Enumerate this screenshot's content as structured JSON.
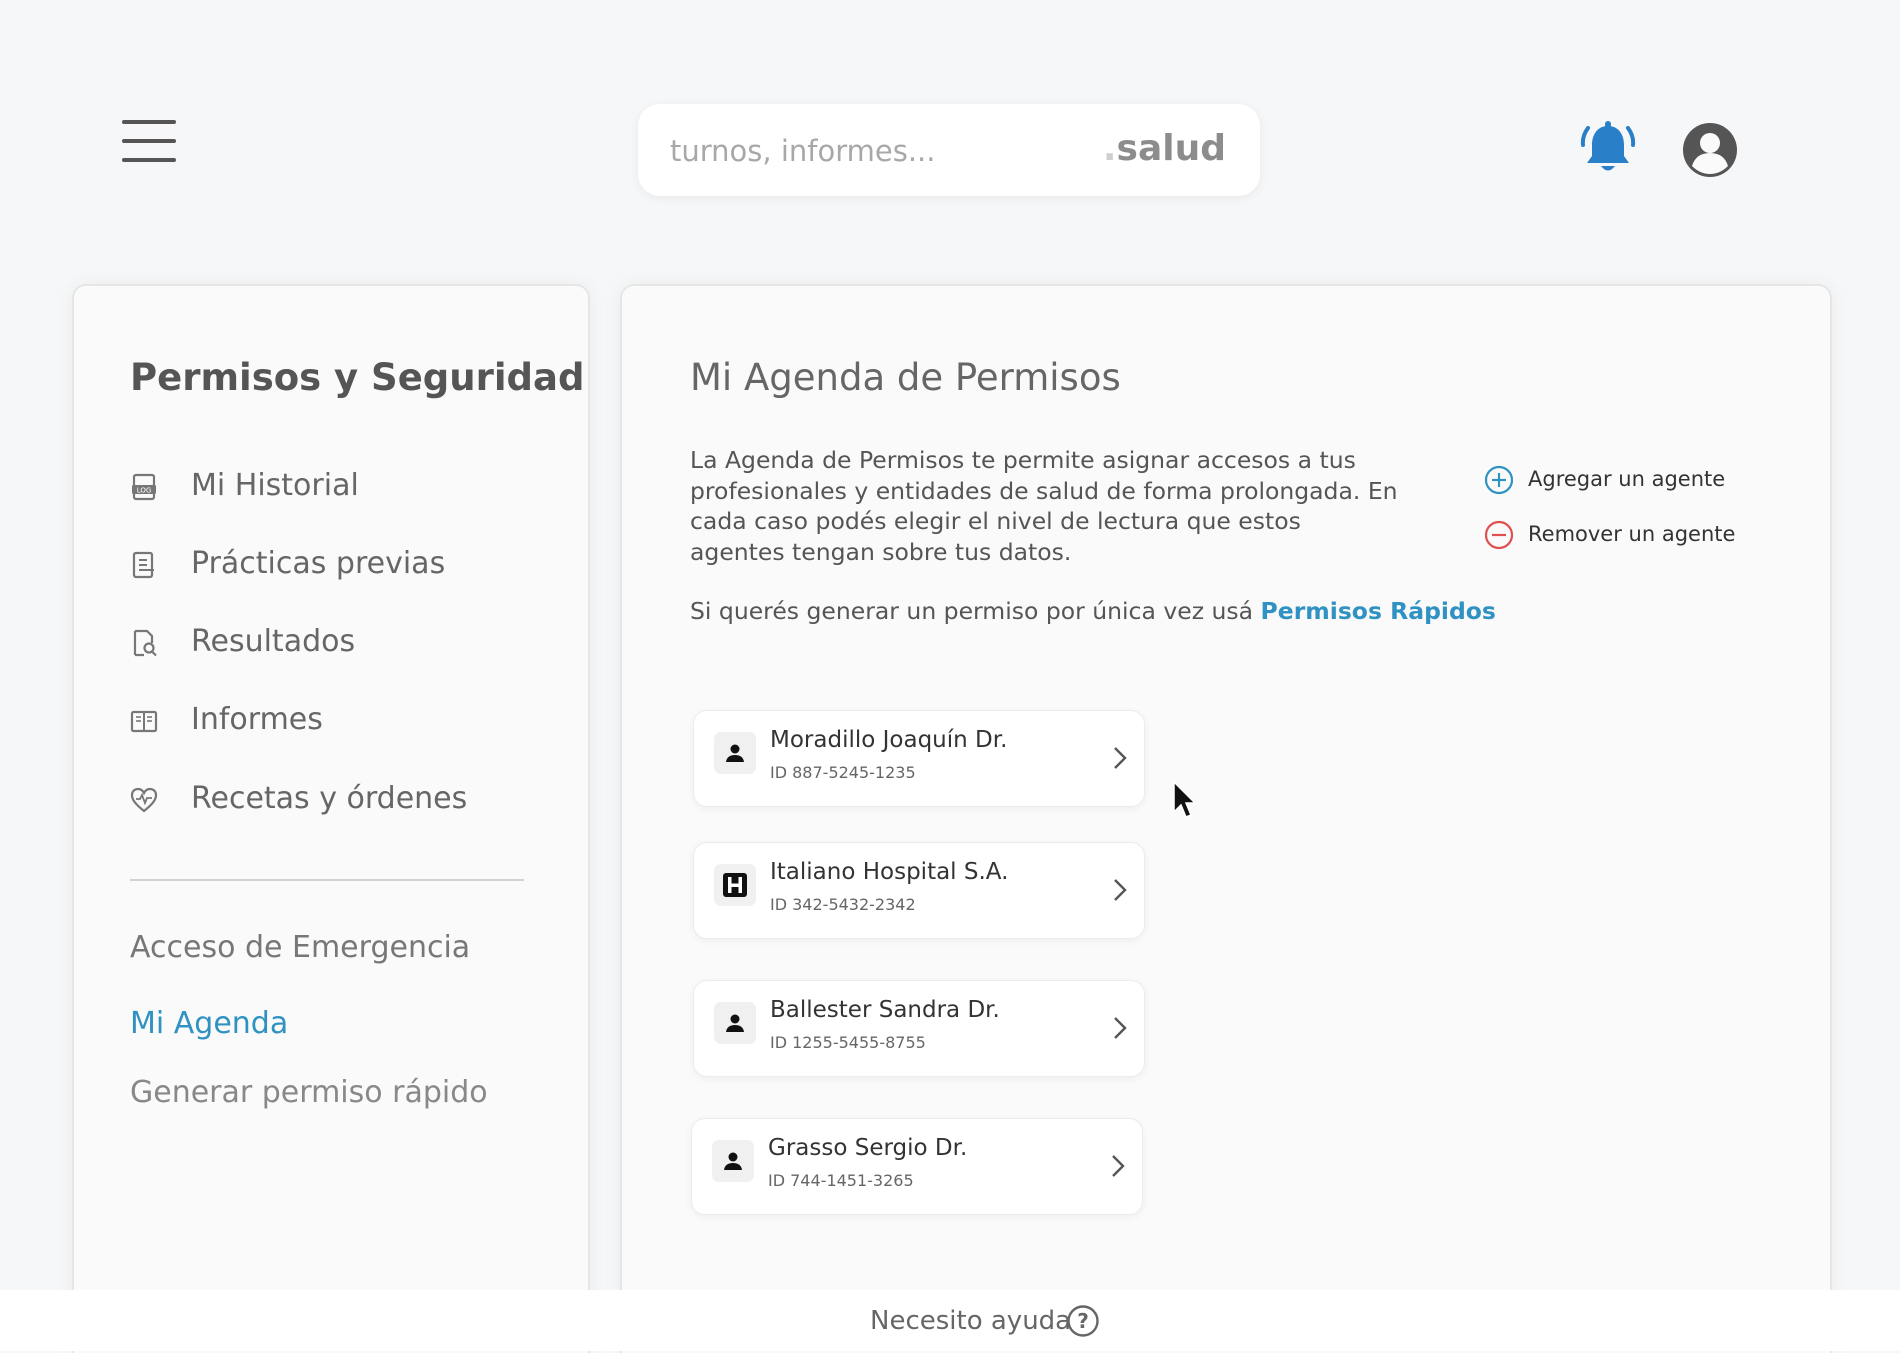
{
  "header": {
    "search": {
      "placeholder": "turnos, informes...",
      "brand_dot": ".",
      "brand_text": "salud"
    },
    "icons": {
      "menu": "hamburger-menu-icon",
      "notifications": "bell-icon",
      "profile": "user-circle-icon"
    },
    "accent_color": "#2a7fc9"
  },
  "sidebar": {
    "title": "Permisos y Seguridad",
    "items": [
      {
        "label": "Mi Historial",
        "icon": "log-document-icon"
      },
      {
        "label": "Prácticas previas",
        "icon": "clipboard-list-icon"
      },
      {
        "label": "Resultados",
        "icon": "file-search-icon"
      },
      {
        "label": "Informes",
        "icon": "report-book-icon"
      },
      {
        "label": "Recetas y órdenes",
        "icon": "heart-pulse-icon"
      }
    ],
    "links": [
      {
        "label": "Acceso de Emergencia",
        "active": false
      },
      {
        "label": "Mi Agenda",
        "active": true
      },
      {
        "label": "Generar permiso rápido",
        "active": false
      }
    ],
    "active_color": "#2f92c2"
  },
  "main": {
    "title": "Mi Agenda de Permisos",
    "description": "La Agenda de Permisos te permite asignar accesos a tus profesionales y entidades de salud de forma prolongada. En cada caso podés elegir el nivel de lectura que estos agentes tengan sobre tus datos.",
    "quick_text": "Si querés generar un permiso por única vez usá ",
    "quick_link": "Permisos Rápidos",
    "actions": {
      "add": {
        "label": "Agregar un agente",
        "icon": "plus-circle-icon",
        "color": "#2f92c2"
      },
      "remove": {
        "label": "Remover un agente",
        "icon": "minus-circle-icon",
        "color": "#e05050"
      }
    },
    "agents": [
      {
        "name": "Moradillo Joaquín Dr.",
        "id": "ID 887-5245-1235",
        "icon": "person-icon"
      },
      {
        "name": "Italiano Hospital S.A.",
        "id": "ID 342-5432-2342",
        "icon": "hospital-icon"
      },
      {
        "name": "Ballester Sandra Dr.",
        "id": "ID 1255-5455-8755",
        "icon": "person-icon"
      },
      {
        "name": "Grasso Sergio Dr.",
        "id": "ID 744-1451-3265",
        "icon": "person-icon"
      }
    ]
  },
  "footer": {
    "help_label": "Necesito ayuda",
    "icon": "question-circle-icon"
  }
}
